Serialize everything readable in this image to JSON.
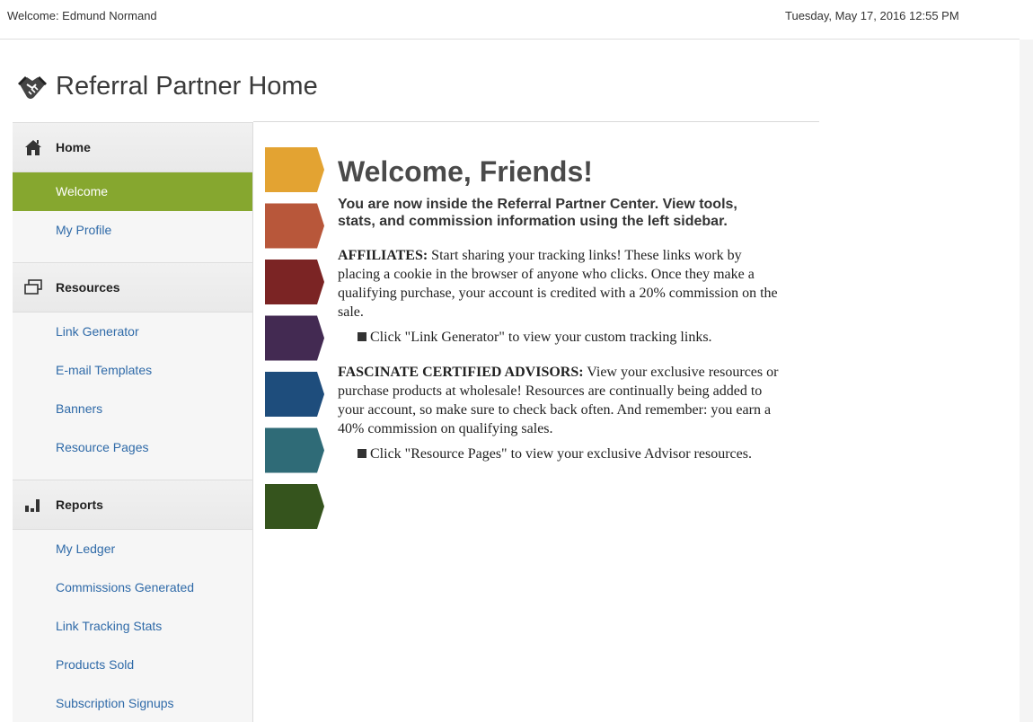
{
  "topbar": {
    "welcome": "Welcome: Edmund Normand",
    "datetime": "Tuesday, May 17, 2016 12:55 PM"
  },
  "page": {
    "title": "Referral Partner Home",
    "title_icon": "handshake-icon"
  },
  "sidebar": {
    "sections": [
      {
        "label": "Home",
        "icon": "house-icon",
        "items": [
          {
            "label": "Welcome",
            "active": true
          },
          {
            "label": "My Profile",
            "active": false
          }
        ]
      },
      {
        "label": "Resources",
        "icon": "windows-icon",
        "items": [
          {
            "label": "Link Generator",
            "active": false
          },
          {
            "label": "E-mail Templates",
            "active": false
          },
          {
            "label": "Banners",
            "active": false
          },
          {
            "label": "Resource Pages",
            "active": false
          }
        ]
      },
      {
        "label": "Reports",
        "icon": "bar-chart-icon",
        "items": [
          {
            "label": "My Ledger",
            "active": false
          },
          {
            "label": "Commissions Generated",
            "active": false
          },
          {
            "label": "Link Tracking Stats",
            "active": false
          },
          {
            "label": "Products Sold",
            "active": false
          },
          {
            "label": "Subscription Signups",
            "active": false
          }
        ]
      }
    ],
    "active_color": "#86a72f",
    "link_color": "#2f6aa8"
  },
  "content": {
    "heading": "Welcome, Friends!",
    "subheading": "You are now inside the Referral Partner Center. View tools, stats, and commission information using the left sidebar.",
    "affiliates_label": "AFFILIATES:",
    "affiliates_text": " Start sharing your tracking links! These links work by placing a cookie in the browser of anyone who clicks. Once they make a qualifying purchase, your account is credited with a 20% commission on the sale.",
    "affiliates_bullet": "Click \"Link Generator\" to view your custom tracking links.",
    "advisors_label": "FASCINATE CERTIFIED ADVISORS:",
    "advisors_text": " View your exclusive resources or purchase products at wholesale! Resources are continually being added to your account, so make sure to check back often. And remember: you earn a 40% commission on qualifying sales.",
    "advisors_bullet": "Click \"Resource Pages\" to view your exclusive Advisor resources."
  },
  "chevron_colors": [
    "#e3a332",
    "#b8573a",
    "#7b2424",
    "#432a52",
    "#1e4d7c",
    "#2f6b77",
    "#35541d"
  ]
}
